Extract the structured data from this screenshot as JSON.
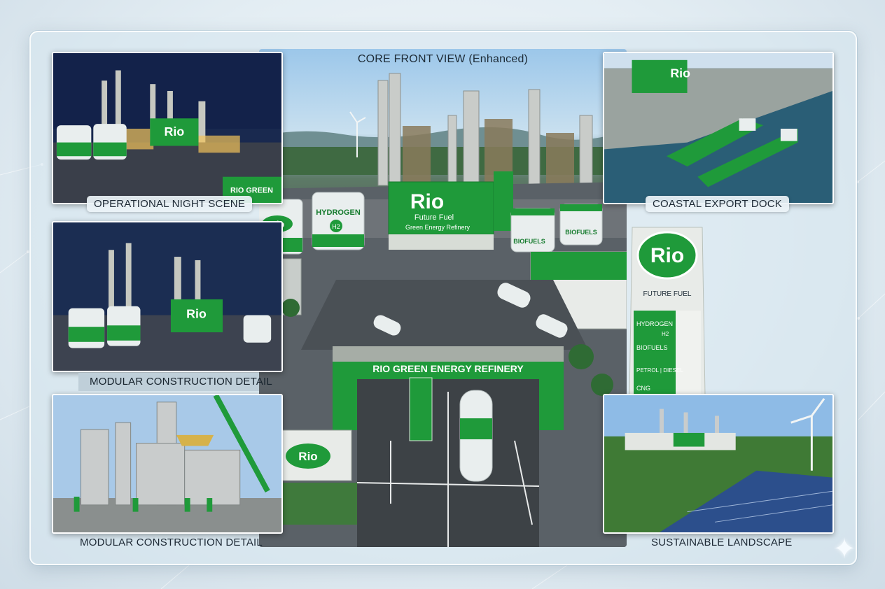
{
  "main": {
    "title": "CORE FRONT VIEW (Enhanced)",
    "main_sign_brand": "Rio",
    "main_sign_line1": "Future Fuel",
    "main_sign_line2": "Green Energy Refinery",
    "gate_sign": "RIO GREEN ENERGY REFINERY",
    "tank_hydrogen": "HYDROGEN",
    "tank_h2": "H2",
    "tank_biofuels_1": "BIOFUELS",
    "tank_biofuels_2": "BIOFUELS",
    "tank_left_brand": "Rio",
    "tower_brand": "Rio",
    "tower_tagline": "FUTURE FUEL",
    "tower_item1": "HYDROGEN",
    "tower_item1_icon": "H2",
    "tower_item2": "BIOFUELS",
    "tower_item3": "PETROL | DIESEL",
    "tower_item4": "CNG",
    "ground_sign_brand": "Rio"
  },
  "panels": {
    "night": {
      "caption": "OPERATIONAL NIGHT SCENE"
    },
    "modular": {
      "caption": "MODULAR CONSTRUCTION DETAIL"
    },
    "construction": {
      "caption": "MODULAR CONSTRUCTION DETAIL"
    },
    "dock": {
      "caption": "COASTAL EXPORT DOCK"
    },
    "landscape": {
      "caption": "SUSTAINABLE LANDSCAPE"
    }
  },
  "colors": {
    "brand_green": "#1f9a3a",
    "brand_dark_green": "#147a2c",
    "tank_white": "#e9eeee"
  },
  "icons": {
    "sparkle": "sparkle-icon"
  }
}
